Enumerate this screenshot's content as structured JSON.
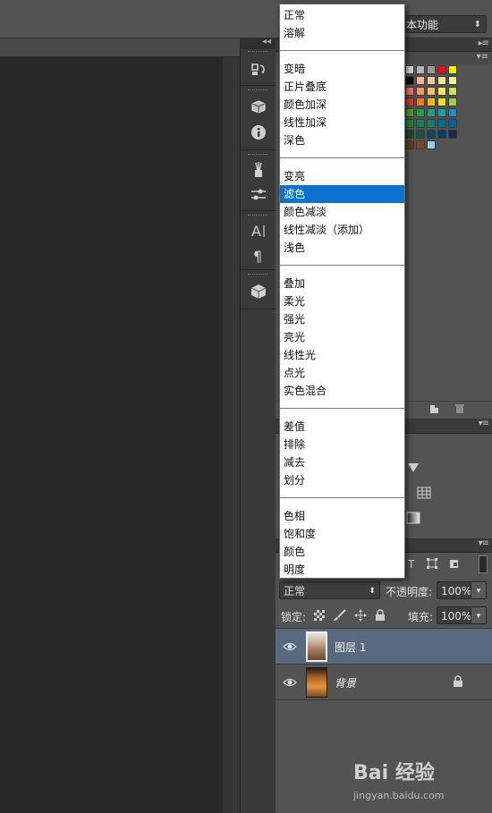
{
  "workspace": {
    "label": "本功能",
    "arrows": "⬍"
  },
  "blend_menu": {
    "groups": [
      [
        "正常",
        "溶解"
      ],
      [
        "变暗",
        "正片叠底",
        "颜色加深",
        "线性加深",
        "深色"
      ],
      [
        "变亮",
        "滤色",
        "颜色减淡",
        "线性减淡（添加）",
        "浅色"
      ],
      [
        "叠加",
        "柔光",
        "强光",
        "亮光",
        "线性光",
        "点光",
        "实色混合"
      ],
      [
        "差值",
        "排除",
        "减去",
        "划分"
      ],
      [
        "色相",
        "饱和度",
        "颜色",
        "明度"
      ]
    ],
    "selected": "滤色"
  },
  "layers_panel": {
    "blend_mode_value": "正常",
    "opacity_label": "不透明度:",
    "opacity_value": "100%",
    "lock_label": "锁定:",
    "fill_label": "填充:",
    "fill_value": "100%",
    "layers": [
      {
        "name": "图层 1",
        "visible": true,
        "selected": true,
        "locked": false
      },
      {
        "name": "背景",
        "visible": true,
        "selected": false,
        "locked": true
      }
    ]
  },
  "swatches": {
    "colors": [
      [
        "#d0d0d0",
        "#b4b4b4",
        "#9a9a9a",
        "#e0101c",
        "#fff200"
      ],
      [
        "#101010",
        "#f6b3a0",
        "#f8c8a0",
        "#fbe39a",
        "#fcf5a0"
      ],
      [
        "#f07060",
        "#f49860",
        "#f8c060",
        "#f6e860",
        "#c8e060"
      ],
      [
        "#e03020",
        "#f07a20",
        "#f8b820",
        "#f0e020",
        "#a0d040"
      ],
      [
        "#40a020",
        "#20a040",
        "#20a080",
        "#20a0a0",
        "#2090c0"
      ],
      [
        "#208030",
        "#108060",
        "#108070",
        "#007090",
        "#0060a0"
      ],
      [
        "#1a4a20",
        "#1a5050",
        "#0a4a60",
        "#0a3a70",
        "#1a2a60"
      ],
      [
        "#6a3a10",
        "#7a4a20",
        "#9ac8e8",
        "",
        ""
      ]
    ]
  },
  "watermark": {
    "logo": "Bai 经验",
    "url": "jingyan.baidu.com"
  }
}
